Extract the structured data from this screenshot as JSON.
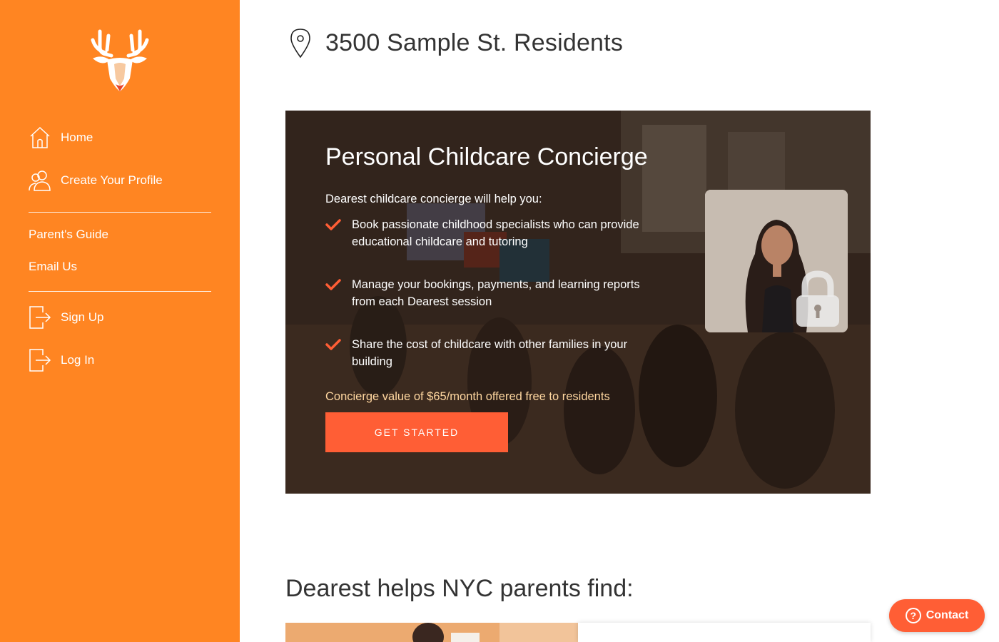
{
  "colors": {
    "sidebar": "#ff8522",
    "accent": "#ff5e35",
    "offer_text": "#ffd7a0"
  },
  "sidebar": {
    "logo_icon": "deer-logo-icon",
    "primary_nav": [
      {
        "label": "Home",
        "icon": "home-icon"
      },
      {
        "label": "Create Your Profile",
        "icon": "users-icon"
      }
    ],
    "links": [
      {
        "label": "Parent's Guide"
      },
      {
        "label": "Email Us"
      }
    ],
    "account_nav": [
      {
        "label": "Sign Up",
        "icon": "sign-in-icon"
      },
      {
        "label": "Log In",
        "icon": "sign-in-icon"
      }
    ]
  },
  "header": {
    "title": "3500 Sample St. Residents",
    "icon": "map-pin-icon"
  },
  "hero": {
    "title": "Personal Childcare Concierge",
    "intro": "Dearest childcare concierge will help you:",
    "bullets": [
      "Book passionate childhood specialists who can provide educational childcare and tutoring",
      "Manage your bookings, payments, and learning reports from each Dearest session",
      "Share the cost of childcare with other families in your building"
    ],
    "offer": "Concierge value of $65/month offered free to residents",
    "cta_label": "GET STARTED"
  },
  "section": {
    "title": "Dearest helps NYC parents find:"
  },
  "contact": {
    "label": "Contact",
    "icon": "question-icon"
  }
}
